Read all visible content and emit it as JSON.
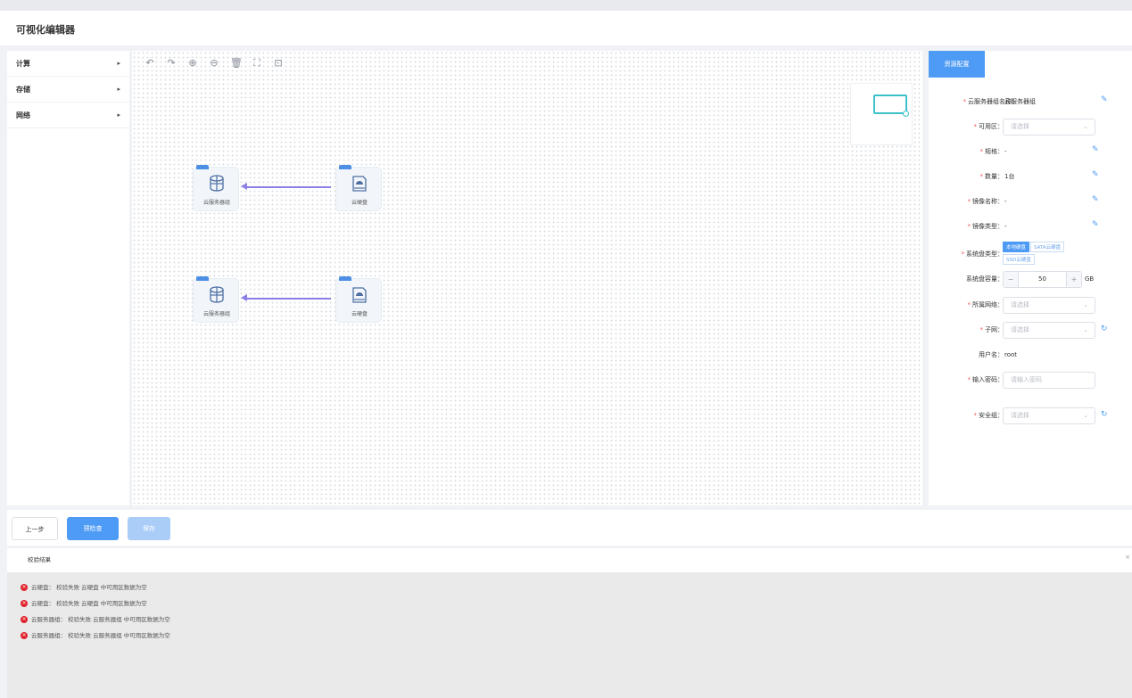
{
  "app": {
    "title": "可视化编辑器"
  },
  "sidebar": {
    "items": [
      {
        "label": "计算",
        "arrow": "▸"
      },
      {
        "label": "存储",
        "arrow": "▸"
      },
      {
        "label": "网络",
        "arrow": "▸"
      }
    ]
  },
  "toolbar": {
    "undo": "↶",
    "redo": "↷",
    "zoom_in": "⊕",
    "zoom_out": "⊖",
    "delete": "🗑",
    "fit": "⛶",
    "export": "⊡"
  },
  "canvas": {
    "nodes": [
      {
        "label": "云服务器组",
        "icon": "server-cluster-icon"
      },
      {
        "label": "云硬盘",
        "icon": "cloud-disk-icon"
      },
      {
        "label": "云服务器组",
        "icon": "server-cluster-icon"
      },
      {
        "label": "云硬盘",
        "icon": "cloud-disk-icon"
      }
    ]
  },
  "panel": {
    "tab": "资源配置",
    "fields": {
      "server_group_name": {
        "label": "云服务器组名称：",
        "value": "云服务器组"
      },
      "zone": {
        "label": "可用区：",
        "placeholder": "请选择"
      },
      "spec": {
        "label": "规格：",
        "value": "-"
      },
      "quantity": {
        "label": "数量：",
        "value": "1台"
      },
      "image_name": {
        "label": "镜像名称：",
        "value": "-"
      },
      "image_type": {
        "label": "镜像类型：",
        "value": "-"
      },
      "sys_disk_type": {
        "label": "系统盘类型：",
        "options": [
          "本地硬盘",
          "SATA云硬盘",
          "SSD云硬盘"
        ],
        "selected": "本地硬盘"
      },
      "sys_disk_size": {
        "label": "系统盘容量：",
        "value": "50",
        "unit": "GB",
        "minus": "−",
        "plus": "+"
      },
      "vpc": {
        "label": "所属网络：",
        "placeholder": "请选择"
      },
      "subnet": {
        "label": "子网：",
        "placeholder": "请选择"
      },
      "username": {
        "label": "用户名：",
        "value": "root"
      },
      "password": {
        "label": "输入密码：",
        "placeholder": "请输入密码"
      },
      "security_group": {
        "label": "安全组：",
        "placeholder": "请选择"
      }
    },
    "required_mark": "*",
    "dropdown_glyph": "⌄",
    "edit_glyph": "✎",
    "refresh_glyph": "↻"
  },
  "actions": {
    "prev": "上一步",
    "check": "预检查",
    "save": "保存"
  },
  "results": {
    "title": "校验结果",
    "close": "×",
    "errors": [
      "云硬盘： 校验失败 云硬盘 中可用区数据为空",
      "云硬盘： 校验失败 云硬盘 中可用区数据为空",
      "云服务器组： 校验失败 云服务器组 中可用区数据为空",
      "云服务器组： 校验失败 云服务器组 中可用区数据为空"
    ],
    "error_glyph": "×"
  },
  "colors": {
    "accent": "#4e9bf5",
    "edge": "#8a7fe6",
    "error": "#e0242c",
    "minimap": "#3cc1c9"
  }
}
